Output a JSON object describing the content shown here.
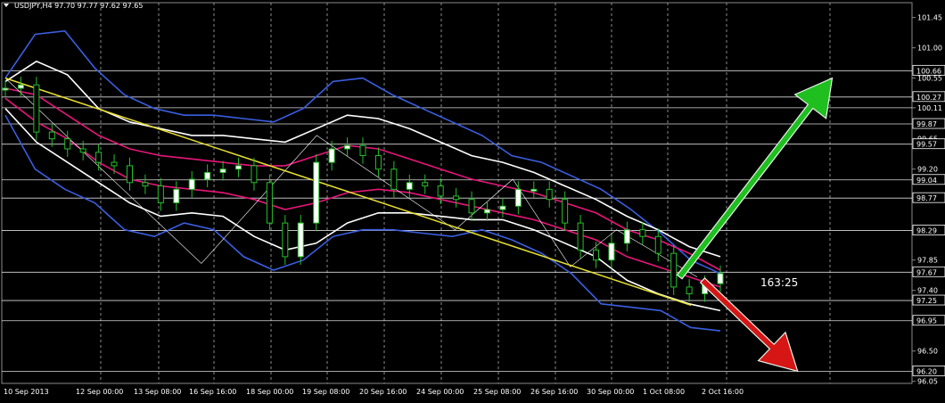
{
  "chart_data": {
    "type": "line",
    "header": {
      "title": "USDJPY,H4",
      "ohlc": [
        "97.70",
        "97.77",
        "97.62",
        "97.65"
      ]
    },
    "timer_label": "163:25",
    "y_axis": {
      "ylim": [
        96.02,
        101.67
      ],
      "tick_labels": [
        "101.45",
        "101.00",
        "100.55",
        "100.11",
        "99.65",
        "99.20",
        "98.77",
        "98.29",
        "97.85",
        "97.40",
        "96.95",
        "96.50",
        "96.05"
      ],
      "level_labels": [
        "100.66",
        "100.27",
        "99.87",
        "99.57",
        "99.04",
        "98.77",
        "98.29",
        "97.67",
        "97.25",
        "96.95",
        "96.20"
      ]
    },
    "x_axis": {
      "tick_labels": [
        "10 Sep 2013",
        "12 Sep 00:00",
        "13 Sep 08:00",
        "16 Sep 16:00",
        "18 Sep 00:00",
        "19 Sep 08:00",
        "20 Sep 16:00",
        "24 Sep 00:00",
        "25 Sep 08:00",
        "26 Sep 16:00",
        "30 Sep 00:00",
        "1 Oct 08:00",
        "2 Oct 16:00"
      ]
    },
    "horizontal_levels": [
      100.66,
      100.27,
      100.11,
      99.87,
      99.57,
      99.04,
      98.77,
      98.29,
      97.67,
      97.25,
      96.95,
      96.2
    ],
    "trendline": {
      "from": [
        0,
        100.55
      ],
      "to": [
        155,
        97.18
      ]
    },
    "series": [
      {
        "role": "price",
        "values": [
          100.4,
          100.45,
          99.75,
          99.65,
          99.5,
          99.45,
          99.3,
          99.25,
          99.0,
          98.95,
          98.7,
          98.9,
          99.05,
          99.15,
          99.2,
          99.25,
          99.0,
          98.4,
          97.9,
          98.4,
          99.3,
          99.5,
          99.55,
          99.4,
          99.2,
          98.9,
          99.0,
          98.95,
          98.8,
          98.75,
          98.55,
          98.6,
          98.65,
          98.9,
          98.9,
          98.75,
          98.4,
          98.0,
          97.85,
          98.1,
          98.3,
          98.2,
          97.95,
          97.45,
          97.35,
          97.5,
          97.65
        ]
      },
      {
        "role": "bollinger-blue",
        "upper": [
          100.55,
          101.2,
          101.25,
          100.7,
          100.3,
          100.1,
          100.0,
          100.0,
          99.95,
          99.9,
          100.1,
          100.5,
          100.55,
          100.3,
          100.1,
          99.9,
          99.7,
          99.4,
          99.3,
          99.1,
          98.9,
          98.6,
          98.25,
          97.85,
          97.65
        ],
        "lower": [
          100.0,
          99.2,
          98.9,
          98.7,
          98.3,
          98.2,
          98.4,
          98.3,
          97.9,
          97.7,
          97.85,
          98.2,
          98.3,
          98.3,
          98.25,
          98.2,
          98.3,
          98.15,
          97.95,
          97.65,
          97.2,
          97.15,
          97.1,
          96.85,
          96.8
        ]
      },
      {
        "role": "bollinger-white",
        "upper": [
          100.5,
          100.8,
          100.6,
          100.1,
          99.9,
          99.8,
          99.7,
          99.7,
          99.65,
          99.6,
          99.8,
          100.0,
          99.95,
          99.8,
          99.6,
          99.4,
          99.3,
          99.15,
          98.95,
          98.75,
          98.5,
          98.3,
          98.05,
          97.9
        ],
        "lower": [
          100.1,
          99.6,
          99.3,
          99.0,
          98.7,
          98.5,
          98.55,
          98.5,
          98.2,
          98.0,
          98.1,
          98.4,
          98.55,
          98.55,
          98.5,
          98.45,
          98.45,
          98.3,
          98.1,
          97.9,
          97.55,
          97.35,
          97.2,
          97.1
        ]
      },
      {
        "role": "bollinger-pink",
        "upper": [
          100.4,
          100.3,
          100.0,
          99.7,
          99.5,
          99.4,
          99.35,
          99.3,
          99.25,
          99.25,
          99.4,
          99.55,
          99.5,
          99.35,
          99.2,
          99.05,
          98.95,
          98.85,
          98.7,
          98.55,
          98.3,
          98.15,
          97.95,
          97.7
        ],
        "lower": [
          100.25,
          99.9,
          99.65,
          99.3,
          99.05,
          98.95,
          98.9,
          98.85,
          98.75,
          98.6,
          98.7,
          98.85,
          98.9,
          98.85,
          98.75,
          98.65,
          98.55,
          98.45,
          98.3,
          98.15,
          97.9,
          97.75,
          97.6,
          97.45
        ]
      }
    ],
    "zigzag": [
      [
        0,
        100.55
      ],
      [
        17,
        97.8
      ],
      [
        27,
        99.7
      ],
      [
        39,
        98.3
      ],
      [
        44,
        99.05
      ],
      [
        49,
        97.75
      ],
      [
        53,
        98.3
      ],
      [
        60,
        97.6
      ]
    ],
    "arrows": [
      {
        "name": "up-arrow",
        "color": "#1fbf1f",
        "from": [
          58,
          97.6
        ],
        "to": [
          70,
          100.55
        ]
      },
      {
        "name": "down-arrow",
        "color": "#d61515",
        "from": [
          60,
          97.55
        ],
        "to": [
          67,
          96.2
        ]
      }
    ],
    "colors": {
      "background": "#000000",
      "grid": "#8a8a8a",
      "level": "#ffffff",
      "trend": "#e8e030",
      "bullish": "#25c02a",
      "bearish": "#ffffff",
      "blue": "#3a5fe0",
      "pink": "#e8157a",
      "white": "#ffffff"
    }
  }
}
